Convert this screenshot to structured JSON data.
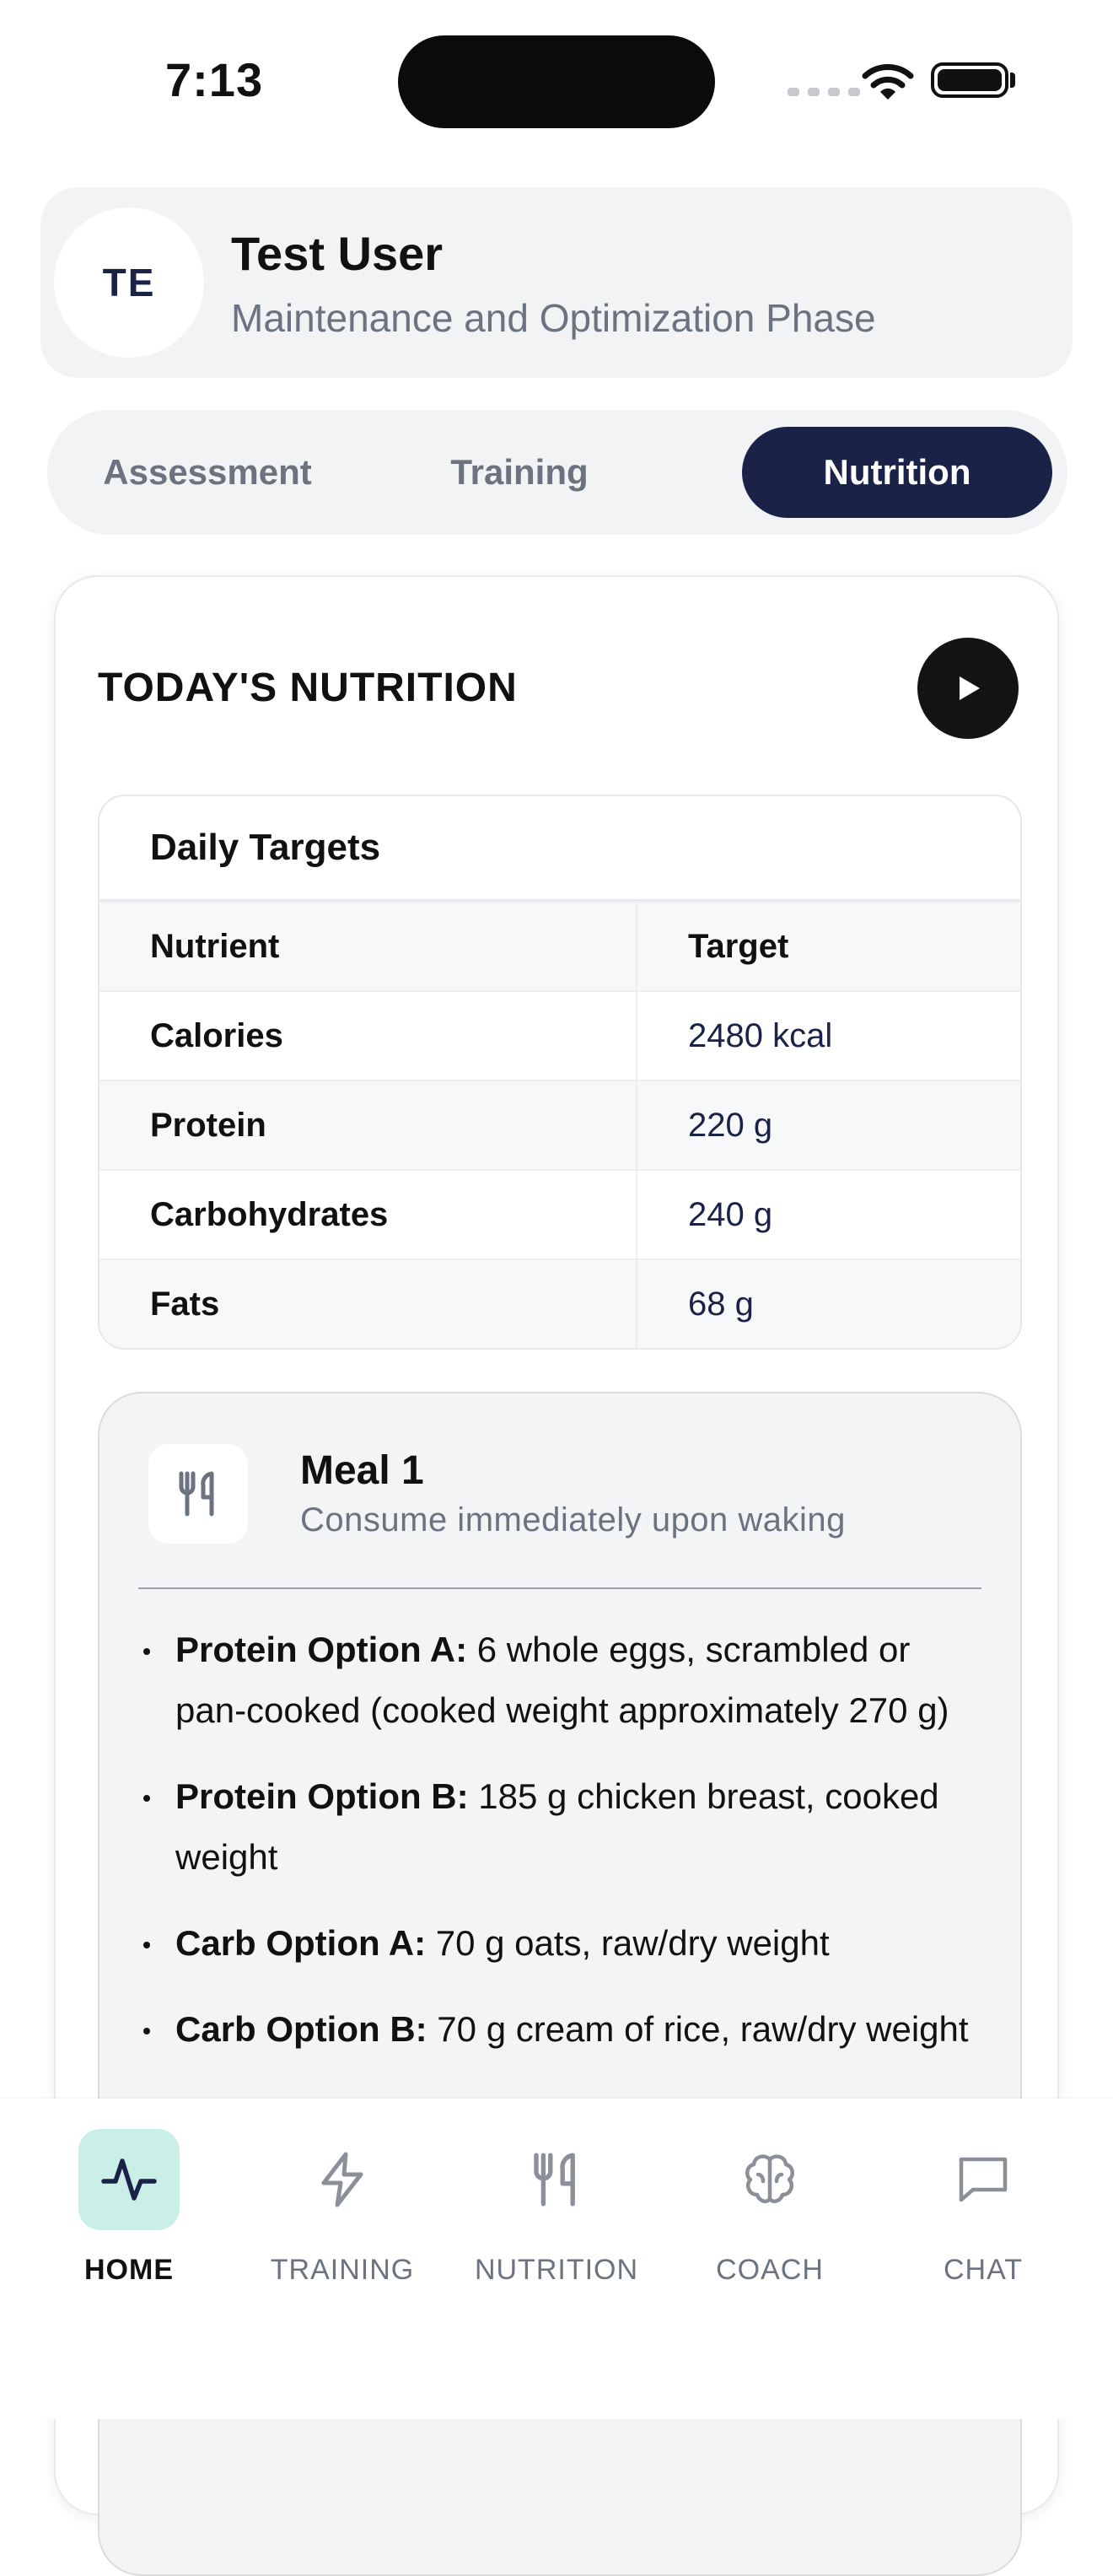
{
  "status_bar": {
    "time": "7:13"
  },
  "profile": {
    "initials": "TE",
    "name": "Test User",
    "phase": "Maintenance and Optimization Phase"
  },
  "tabs": [
    {
      "label": "Assessment",
      "active": false
    },
    {
      "label": "Training",
      "active": false
    },
    {
      "label": "Nutrition",
      "active": true
    }
  ],
  "nutrition": {
    "title": "TODAY'S NUTRITION",
    "targets": {
      "title": "Daily Targets",
      "columns": [
        "Nutrient",
        "Target"
      ],
      "rows": [
        {
          "nutrient": "Calories",
          "target": "2480 kcal"
        },
        {
          "nutrient": "Protein",
          "target": "220 g"
        },
        {
          "nutrient": "Carbohydrates",
          "target": "240 g"
        },
        {
          "nutrient": "Fats",
          "target": "68 g"
        }
      ]
    },
    "meal": {
      "icon": "fork-knife-icon",
      "title": "Meal 1",
      "subtitle": "Consume immediately upon waking",
      "items": [
        {
          "label": "Protein Option A:",
          "text": " 6 whole eggs, scrambled or pan-cooked (cooked weight approximately 270 g)"
        },
        {
          "label": "Protein Option B:",
          "text": " 185 g chicken breast, cooked weight"
        },
        {
          "label": "Carb Option A:",
          "text": " 70 g oats, raw/dry weight"
        },
        {
          "label": "Carb Option B:",
          "text": " 70 g cream of rice, raw/dry weight"
        }
      ]
    }
  },
  "nav": [
    {
      "label": "HOME",
      "icon": "pulse-icon",
      "active": true
    },
    {
      "label": "TRAINING",
      "icon": "lightning-icon",
      "active": false
    },
    {
      "label": "NUTRITION",
      "icon": "fork-knife-icon",
      "active": false
    },
    {
      "label": "COACH",
      "icon": "brain-icon",
      "active": false
    },
    {
      "label": "CHAT",
      "icon": "chat-bubble-icon",
      "active": false
    }
  ],
  "colors": {
    "accent": "#1b2248",
    "active_nav_bg": "#c9efe6",
    "muted": "#6b7280"
  }
}
